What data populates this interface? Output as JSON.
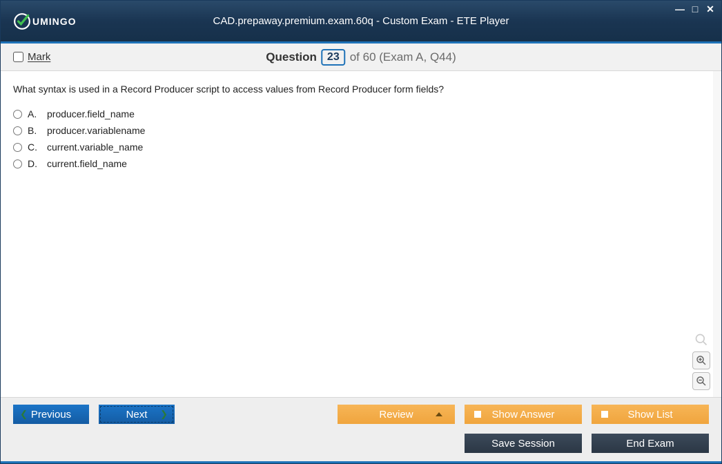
{
  "window": {
    "title": "CAD.prepaway.premium.exam.60q - Custom Exam - ETE Player",
    "brand": "UMINGO"
  },
  "header": {
    "mark_label": "Mark",
    "question_label": "Question",
    "current_number": "23",
    "of_text": "of 60 (Exam A, Q44)"
  },
  "question": {
    "text": "What syntax is used in a Record Producer script to access values from Record Producer form fields?",
    "options": [
      {
        "letter": "A.",
        "text": "producer.field_name"
      },
      {
        "letter": "B.",
        "text": "producer.variablename"
      },
      {
        "letter": "C.",
        "text": "current.variable_name"
      },
      {
        "letter": "D.",
        "text": "current.field_name"
      }
    ]
  },
  "footer": {
    "previous": "Previous",
    "next": "Next",
    "review": "Review",
    "show_answer": "Show Answer",
    "show_list": "Show List",
    "save_session": "Save Session",
    "end_exam": "End Exam"
  }
}
